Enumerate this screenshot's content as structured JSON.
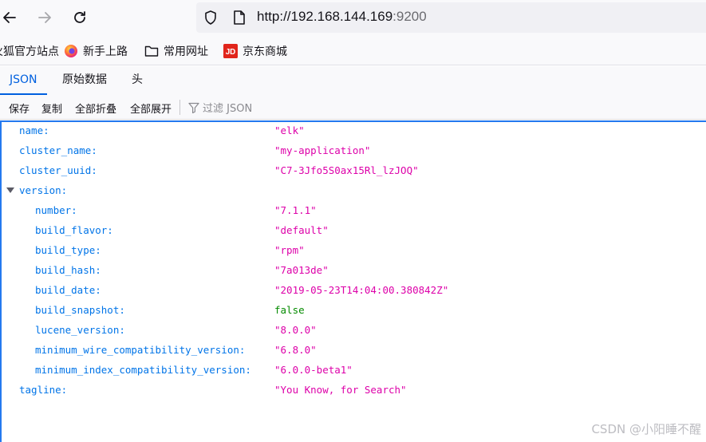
{
  "browser": {
    "url_host": "http://192.168.144.169",
    "url_port": ":9200"
  },
  "bookmarks": [
    {
      "label": "火狐官方站点",
      "icon": "firefox-icon"
    },
    {
      "label": "新手上路",
      "icon": "firefox-icon"
    },
    {
      "label": "常用网址",
      "icon": "folder-icon"
    },
    {
      "label": "京东商城",
      "icon": "jd-icon"
    }
  ],
  "tabs": [
    {
      "label": "JSON",
      "active": true
    },
    {
      "label": "原始数据",
      "active": false
    },
    {
      "label": "头",
      "active": false
    }
  ],
  "actions": {
    "save": "保存",
    "copy": "复制",
    "collapse_all": "全部折叠",
    "expand_all": "全部展开",
    "filter_placeholder": "过滤 JSON"
  },
  "json": [
    {
      "key": "name:",
      "value": "\"elk\"",
      "type": "str",
      "indent": 0
    },
    {
      "key": "cluster_name:",
      "value": "\"my-application\"",
      "type": "str",
      "indent": 0
    },
    {
      "key": "cluster_uuid:",
      "value": "\"C7-3Jfo5S0ax15Rl_lzJOQ\"",
      "type": "str",
      "indent": 0
    },
    {
      "key": "version:",
      "value": "",
      "type": "obj",
      "indent": 0
    },
    {
      "key": "number:",
      "value": "\"7.1.1\"",
      "type": "str",
      "indent": 1
    },
    {
      "key": "build_flavor:",
      "value": "\"default\"",
      "type": "str",
      "indent": 1
    },
    {
      "key": "build_type:",
      "value": "\"rpm\"",
      "type": "str",
      "indent": 1
    },
    {
      "key": "build_hash:",
      "value": "\"7a013de\"",
      "type": "str",
      "indent": 1
    },
    {
      "key": "build_date:",
      "value": "\"2019-05-23T14:04:00.380842Z\"",
      "type": "str",
      "indent": 1
    },
    {
      "key": "build_snapshot:",
      "value": "false",
      "type": "bool",
      "indent": 1
    },
    {
      "key": "lucene_version:",
      "value": "\"8.0.0\"",
      "type": "str",
      "indent": 1
    },
    {
      "key": "minimum_wire_compatibility_version:",
      "value": "\"6.8.0\"",
      "type": "str",
      "indent": 1
    },
    {
      "key": "minimum_index_compatibility_version:",
      "value": "\"6.0.0-beta1\"",
      "type": "str",
      "indent": 1
    },
    {
      "key": "tagline:",
      "value": "\"You Know, for Search\"",
      "type": "str",
      "indent": 0
    }
  ],
  "watermark": "CSDN @小阳睡不醒",
  "colors": {
    "accent": "#0060df",
    "key": "#0074e8",
    "string": "#dd00a9",
    "boolean": "#058b00"
  }
}
